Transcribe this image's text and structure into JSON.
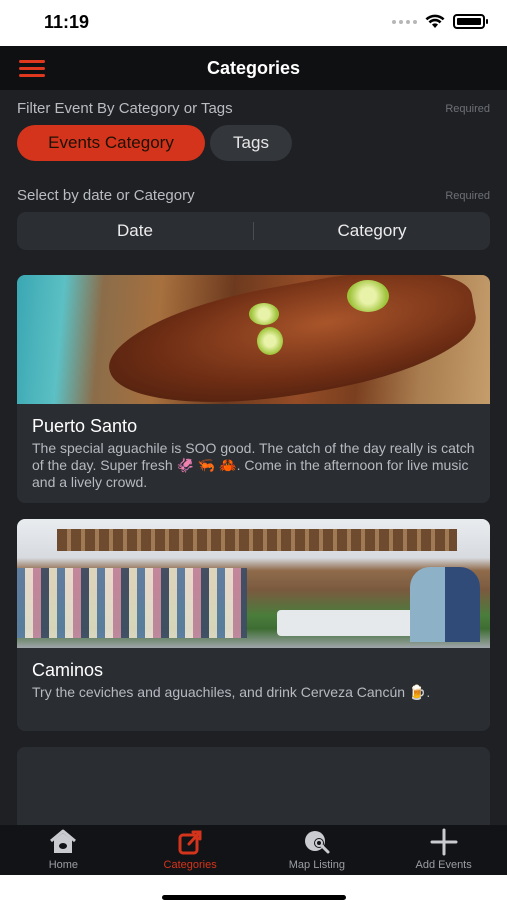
{
  "status_bar": {
    "time": "11:19"
  },
  "header": {
    "title": "Categories"
  },
  "filter": {
    "label": "Filter Event By Category or Tags",
    "required": "Required",
    "options": [
      "Events Category",
      "Tags"
    ],
    "selected": "Events Category"
  },
  "select": {
    "label": "Select by date or Category",
    "required": "Required",
    "options": [
      "Date",
      "Category"
    ]
  },
  "cards": [
    {
      "title": "Puerto Santo",
      "description": "The special aguachile is SOO good. The catch of the day really is catch of the day. Super fresh 🦑 🦐 🦀. Come in the afternoon for live music and a lively crowd."
    },
    {
      "title": "Caminos",
      "description": "Try the ceviches and aguachiles, and drink Cerveza Cancún 🍺."
    }
  ],
  "tabbar": {
    "items": [
      {
        "label": "Home",
        "icon": "home-icon"
      },
      {
        "label": "Categories",
        "icon": "share-icon"
      },
      {
        "label": "Map Listing",
        "icon": "map-search-icon"
      },
      {
        "label": "Add Events",
        "icon": "plus-icon"
      }
    ],
    "active": "Categories"
  },
  "colors": {
    "accent": "#d4341b",
    "background": "#1e2024",
    "card": "#2a2d32"
  }
}
